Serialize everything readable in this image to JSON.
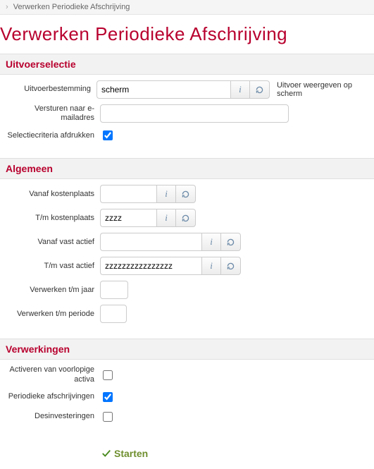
{
  "breadcrumb": {
    "title": "Verwerken Periodieke Afschrijving"
  },
  "page": {
    "title": "Verwerken Periodieke Afschrijving"
  },
  "sections": {
    "uitvoer": {
      "header": "Uitvoerselectie",
      "uitvoerbestemming_label": "Uitvoerbestemming",
      "uitvoerbestemming_value": "scherm",
      "uitvoer_side_text": "Uitvoer weergeven op scherm",
      "email_label": "Versturen naar e-mailadres",
      "email_value": "",
      "selectie_label": "Selectiecriteria afdrukken",
      "selectie_checked": true
    },
    "algemeen": {
      "header": "Algemeen",
      "vanaf_kp_label": "Vanaf kostenplaats",
      "vanaf_kp_value": "",
      "tm_kp_label": "T/m kostenplaats",
      "tm_kp_value": "zzzz",
      "vanaf_va_label": "Vanaf vast actief",
      "vanaf_va_value": "",
      "tm_va_label": "T/m vast actief",
      "tm_va_value": "zzzzzzzzzzzzzzzz",
      "jaar_label": "Verwerken t/m jaar",
      "jaar_value": "",
      "periode_label": "Verwerken t/m periode",
      "periode_value": ""
    },
    "verwerkingen": {
      "header": "Verwerkingen",
      "activeren_label": "Activeren van voorlopige activa",
      "activeren_checked": false,
      "periodieke_label": "Periodieke afschrijvingen",
      "periodieke_checked": true,
      "desinvest_label": "Desinvesteringen",
      "desinvest_checked": false
    }
  },
  "actions": {
    "start_label": "Starten"
  },
  "icons": {
    "info": "i",
    "refresh": "↻"
  }
}
